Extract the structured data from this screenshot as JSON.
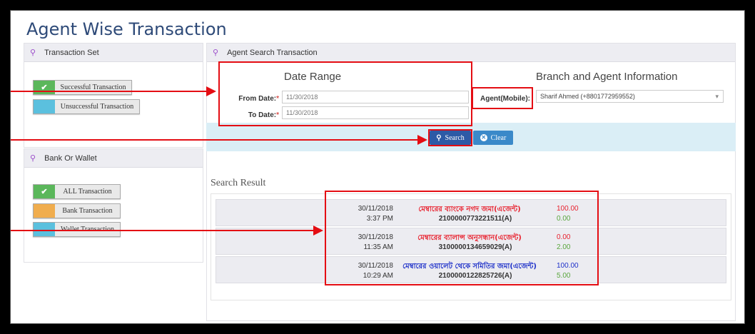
{
  "page": {
    "title": "Agent Wise Transaction"
  },
  "left_panel_top": {
    "header": "Transaction Set",
    "buttons": [
      "Successful Transaction",
      "Unsuccessful Transaction"
    ]
  },
  "left_panel_bottom": {
    "header": "Bank Or Wallet",
    "buttons": [
      "ALL Transaction",
      "Bank Transaction",
      "Wallet Transaction"
    ]
  },
  "main_panel": {
    "header": "Agent Search Transaction",
    "date_range": {
      "title": "Date Range",
      "from_label": "From Date:",
      "from_value": "11/30/2018",
      "to_label": "To Date:",
      "to_value": "11/30/2018",
      "required_mark": "*"
    },
    "branch": {
      "title": "Branch and Agent Information",
      "agent_label": "Agent(Mobile):",
      "agent_value": "Sharif Ahmed (+8801772959552)",
      "dropdown_icon": "▾"
    },
    "actions": {
      "search_label": "Search",
      "clear_label": "Clear"
    }
  },
  "results": {
    "title": "Search Result",
    "rows": [
      {
        "date": "30/11/2018",
        "time": "3:37 PM",
        "type": "মেম্বারের ব্যাংকে নগদ জমা(এজেন্ট)",
        "account": "2100000773221511(A)",
        "amount1": "100.00",
        "amount2": "0.00"
      },
      {
        "date": "30/11/2018",
        "time": "11:35 AM",
        "type": "মেম্বারের ব্যালান্স অনুসন্ধান(এজেন্ট)",
        "account": "3100000134659029(A)",
        "amount1": "0.00",
        "amount2": "2.00"
      },
      {
        "date": "30/11/2018",
        "time": "10:29 AM",
        "type": "মেম্বারের ওয়ালেট থেকে সমিতির জমা(এজেন্ট)",
        "account": "2100000122825726(A)",
        "amount1": "100.00",
        "amount2": "5.00"
      }
    ]
  },
  "colors": {
    "title": "#2e4a78",
    "highlight": "#e40d13",
    "green": "#5bb75b",
    "cyan": "#5bc0de",
    "orange": "#f0ad4e",
    "search_btn": "#2d5aa6",
    "clear_btn": "#3a89c9"
  }
}
